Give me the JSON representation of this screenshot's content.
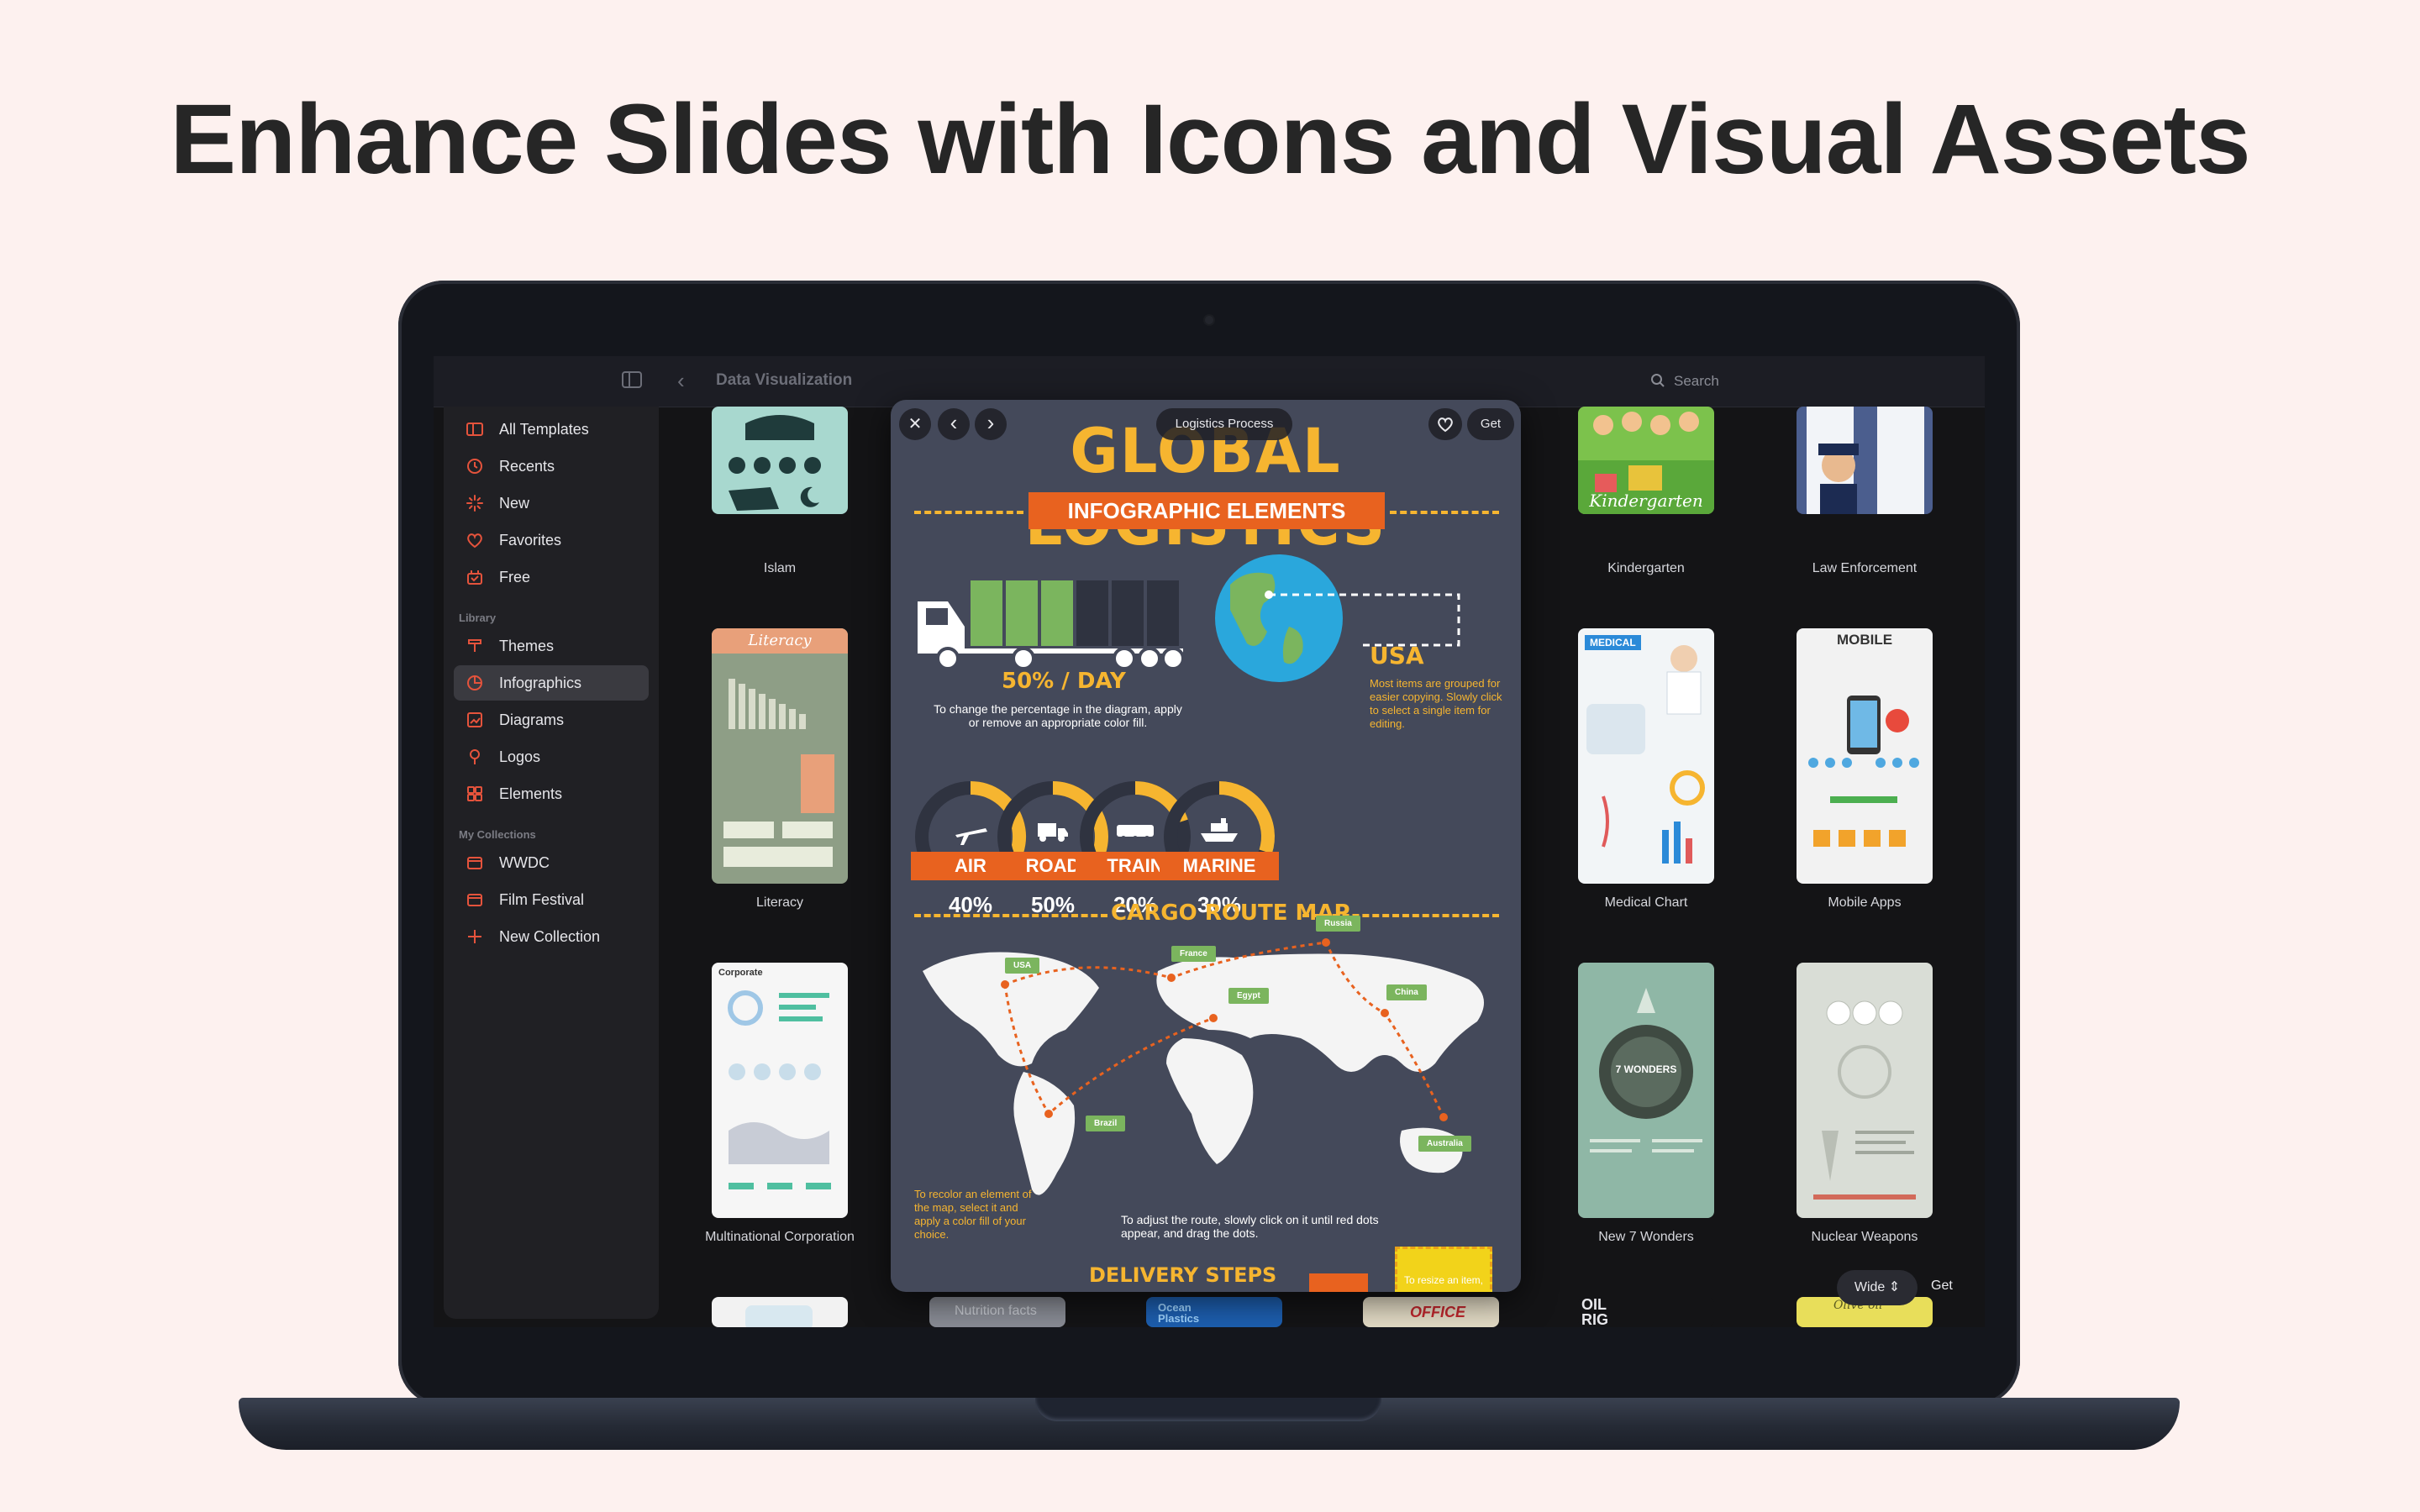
{
  "hero": {
    "title": "Enhance Slides with Icons and Visual Assets"
  },
  "toolbar": {
    "breadcrumb": "Data Visualization",
    "search_label": "Search"
  },
  "sidebar": {
    "items": [
      {
        "label": "All Templates",
        "icon": "all-templates-icon"
      },
      {
        "label": "Recents",
        "icon": "clock-icon"
      },
      {
        "label": "New",
        "icon": "sparkle-icon"
      },
      {
        "label": "Favorites",
        "icon": "heart-icon"
      },
      {
        "label": "Free",
        "icon": "gift-icon"
      }
    ],
    "library_heading": "Library",
    "library": [
      {
        "label": "Themes",
        "icon": "brush-icon"
      },
      {
        "label": "Infographics",
        "icon": "pie-icon",
        "active": true
      },
      {
        "label": "Diagrams",
        "icon": "diagram-icon"
      },
      {
        "label": "Logos",
        "icon": "pin-icon"
      },
      {
        "label": "Elements",
        "icon": "grid-icon"
      }
    ],
    "collections_heading": "My Collections",
    "collections": [
      {
        "label": "WWDC",
        "icon": "folder-icon"
      },
      {
        "label": "Film Festival",
        "icon": "folder-icon"
      },
      {
        "label": "New Collection",
        "icon": "plus-icon"
      }
    ],
    "accent_color": "#e5533c"
  },
  "gallery": {
    "left": [
      {
        "label": "Islam",
        "bg": "#a8d8cf",
        "thumb_title": ""
      },
      {
        "label": "Literacy",
        "bg": "#8e9e86",
        "thumb_title": "Literacy"
      },
      {
        "label": "Multinational Corporation",
        "bg": "#f4f4f4",
        "thumb_title": "Corporate"
      }
    ],
    "right_a": [
      {
        "label": "Kindergarten",
        "bg": "#7cc24c",
        "thumb_title": "Kindergarten"
      },
      {
        "label": "Medical Chart",
        "bg": "#f2f5f7",
        "thumb_title": "MEDICAL"
      },
      {
        "label": "New 7 Wonders",
        "bg": "#8fb7a6",
        "thumb_title": "7 WONDERS"
      }
    ],
    "right_b": [
      {
        "label": "Law Enforcement",
        "bg": "#4b5e8e",
        "thumb_title": ""
      },
      {
        "label": "Mobile Apps",
        "bg": "#f2f2f2",
        "thumb_title": "MOBILE"
      },
      {
        "label": "Nuclear Weapons",
        "bg": "#d9ddd6",
        "thumb_title": ""
      }
    ],
    "bottom_peeks": [
      "Nutrition facts",
      "Ocean Plastics",
      "OFFICE",
      "OIL RIG",
      "Olive oil"
    ],
    "wide_label": "Wide",
    "get_label": "Get"
  },
  "modal": {
    "title": "Logistics Process",
    "get_label": "Get",
    "headline": "GLOBAL LOGISTICS",
    "ribbon": "INFOGRAPHIC ELEMENTS",
    "truck_caption": "50% / DAY",
    "truck_note": "To change the percentage in the diagram, apply or remove an appropriate color fill.",
    "globe_label": "USA",
    "globe_note": "Most items are grouped for easier copying. Slowly click to select a single item for editing.",
    "gauges": [
      {
        "label": "AIR",
        "value": "40%",
        "pct": 40,
        "icon": "plane-icon"
      },
      {
        "label": "ROAD",
        "value": "50%",
        "pct": 50,
        "icon": "truck-icon"
      },
      {
        "label": "TRAIN",
        "value": "20%",
        "pct": 20,
        "icon": "train-icon"
      },
      {
        "label": "MARINE",
        "value": "30%",
        "pct": 30,
        "icon": "ship-icon"
      }
    ],
    "map_title": "CARGO ROUTE MAP",
    "flags": [
      "USA",
      "France",
      "Russia",
      "Egypt",
      "China",
      "Brazil",
      "Australia"
    ],
    "map_note_left": "To recolor an element of the map, select it and apply a color fill of your choice.",
    "map_note_bottom": "To adjust the route, slowly click on it until red dots appear, and drag the dots.",
    "delivery_title": "DELIVERY STEPS",
    "resize_note": "To resize an item,",
    "colors": {
      "bg": "#44495a",
      "yellow": "#f6b530",
      "orange": "#e8621f",
      "green": "#7bb55e",
      "globe": "#2aa7dc"
    }
  }
}
